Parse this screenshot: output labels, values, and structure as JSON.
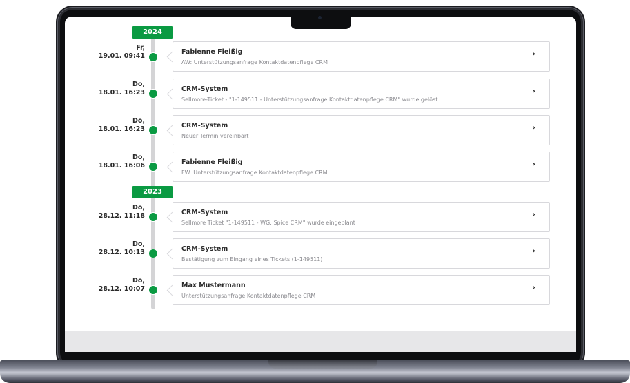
{
  "timeline": {
    "groups": [
      {
        "year": "2024",
        "entries": [
          {
            "day": "Fr,",
            "datetime": "19.01. 09:41",
            "sender": "Fabienne Fleißig",
            "subject": "AW: Unterstützungsanfrage Kontaktdatenpflege CRM"
          },
          {
            "day": "Do,",
            "datetime": "18.01. 16:23",
            "sender": "CRM-System",
            "subject": "Sellmore-Ticket - \"1-149511 - Unterstützungsanfrage Kontaktdatenpflege CRM\" wurde gelöst"
          },
          {
            "day": "Do,",
            "datetime": "18.01. 16:23",
            "sender": "CRM-System",
            "subject": "Neuer Termin vereinbart"
          },
          {
            "day": "Do,",
            "datetime": "18.01. 16:06",
            "sender": "Fabienne Fleißig",
            "subject": "FW: Unterstützungsanfrage Kontaktdatenpflege CRM"
          }
        ]
      },
      {
        "year": "2023",
        "entries": [
          {
            "day": "Do,",
            "datetime": "28.12. 11:18",
            "sender": "CRM-System",
            "subject": "Sellmore Ticket \"1-149511 - WG: Spice CRM\" wurde eingeplant"
          },
          {
            "day": "Do,",
            "datetime": "28.12. 10:13",
            "sender": "CRM-System",
            "subject": "Bestätigung zum Eingang eines Tickets (1-149511)"
          },
          {
            "day": "Do,",
            "datetime": "28.12. 10:07",
            "sender": "Max Mustermann",
            "subject": "Unterstützungsanfrage Kontaktdatenpflege CRM"
          }
        ]
      }
    ],
    "chevron_icon": "›"
  },
  "colors": {
    "accent": "#0a9a42",
    "rail": "#d4d4d6",
    "card_border": "#d8d8dc",
    "frame": "#2b2c31"
  }
}
